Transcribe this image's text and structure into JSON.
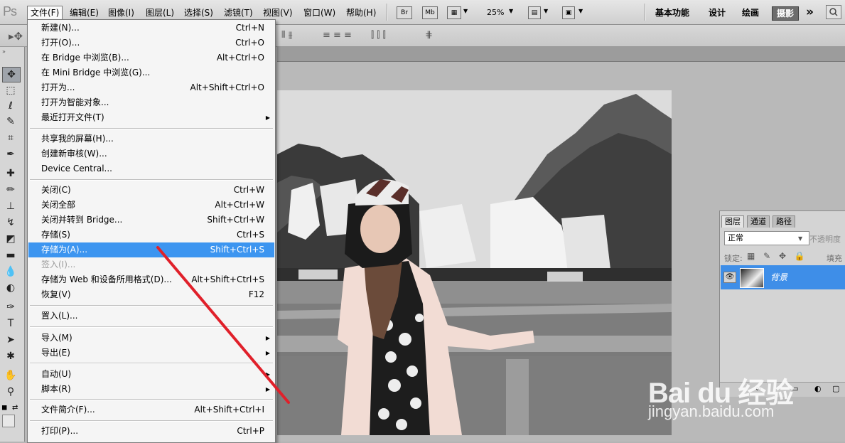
{
  "app": {
    "logo": "Ps",
    "menu": [
      "文件(F)",
      "编辑(E)",
      "图像(I)",
      "图层(L)",
      "选择(S)",
      "滤镜(T)",
      "视图(V)",
      "窗口(W)",
      "帮助(H)"
    ],
    "bridge_btn": "Br",
    "mini_bridge_btn": "Mb",
    "zoom": "25%",
    "workspaces": [
      "基本功能",
      "设计",
      "绘画",
      "摄影"
    ],
    "active_workspace": "摄影",
    "more": "»"
  },
  "file_menu": {
    "items": [
      {
        "label": "新建(N)...",
        "shortcut": "Ctrl+N"
      },
      {
        "label": "打开(O)...",
        "shortcut": "Ctrl+O"
      },
      {
        "label": "在 Bridge 中浏览(B)...",
        "shortcut": "Alt+Ctrl+O"
      },
      {
        "label": "在 Mini Bridge 中浏览(G)...",
        "shortcut": ""
      },
      {
        "label": "打开为...",
        "shortcut": "Alt+Shift+Ctrl+O"
      },
      {
        "label": "打开为智能对象...",
        "shortcut": ""
      },
      {
        "label": "最近打开文件(T)",
        "shortcut": "",
        "submenu": true
      },
      {
        "label": "共享我的屏幕(H)...",
        "shortcut": ""
      },
      {
        "label": "创建新审核(W)...",
        "shortcut": ""
      },
      {
        "label": "Device Central...",
        "shortcut": ""
      },
      {
        "label": "关闭(C)",
        "shortcut": "Ctrl+W"
      },
      {
        "label": "关闭全部",
        "shortcut": "Alt+Ctrl+W"
      },
      {
        "label": "关闭并转到 Bridge...",
        "shortcut": "Shift+Ctrl+W"
      },
      {
        "label": "存储(S)",
        "shortcut": "Ctrl+S"
      },
      {
        "label": "存储为(A)...",
        "shortcut": "Shift+Ctrl+S",
        "highlighted": true
      },
      {
        "label": "签入(I)...",
        "shortcut": "",
        "disabled": true
      },
      {
        "label": "存储为 Web 和设备所用格式(D)...",
        "shortcut": "Alt+Shift+Ctrl+S"
      },
      {
        "label": "恢复(V)",
        "shortcut": "F12"
      },
      {
        "label": "置入(L)...",
        "shortcut": ""
      },
      {
        "label": "导入(M)",
        "shortcut": "",
        "submenu": true
      },
      {
        "label": "导出(E)",
        "shortcut": "",
        "submenu": true
      },
      {
        "label": "自动(U)",
        "shortcut": "",
        "submenu": true
      },
      {
        "label": "脚本(R)",
        "shortcut": "",
        "submenu": true
      },
      {
        "label": "文件简介(F)...",
        "shortcut": "Alt+Shift+Ctrl+I"
      },
      {
        "label": "打印(P)...",
        "shortcut": "Ctrl+P"
      }
    ]
  },
  "layers_panel": {
    "tabs": [
      "图层",
      "通道",
      "路径"
    ],
    "blend_mode": "正常",
    "opacity_label": "不透明度",
    "lock_label": "锁定:",
    "fill_label": "填充",
    "layer_name": "背景"
  },
  "watermark": {
    "logo": "Bai du 经验",
    "url": "jingyan.baidu.com"
  },
  "colors": {
    "highlight": "#3c95f0",
    "annotation_line": "#e0202a"
  }
}
